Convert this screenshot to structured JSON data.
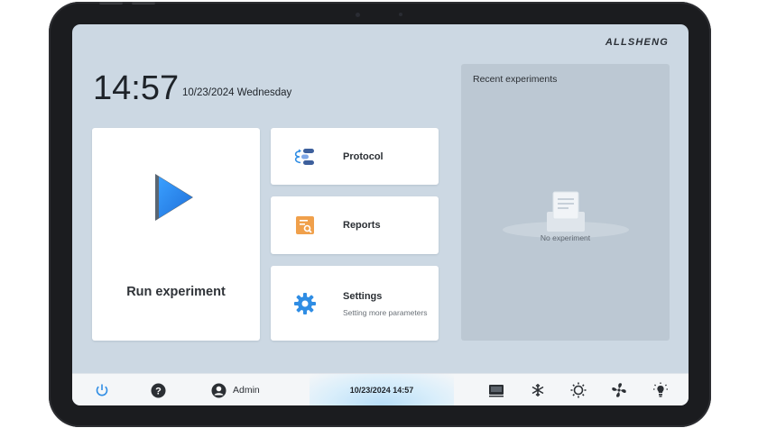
{
  "brand": "ALLSHENG",
  "clock": {
    "time": "14:57",
    "date": "10/23/2024 Wednesday"
  },
  "run": {
    "label": "Run experiment",
    "icon": "play-icon"
  },
  "menu": [
    {
      "title": "Protocol",
      "subtitle": "",
      "icon": "protocol-icon"
    },
    {
      "title": "Reports",
      "subtitle": "",
      "icon": "report-icon"
    },
    {
      "title": "Settings",
      "subtitle": "Setting more parameters",
      "icon": "gear-icon"
    }
  ],
  "recent": {
    "title": "Recent experiments",
    "empty_text": "No experiment"
  },
  "bottom_bar": {
    "user": "Admin",
    "datetime": "10/23/2024 14:57",
    "icons": [
      "power-icon",
      "help-icon",
      "user-icon",
      "screen-icon",
      "snowflake-icon",
      "brightness-icon",
      "fan-icon",
      "bulb-icon"
    ]
  },
  "colors": {
    "accent": "#2f8de4",
    "screen_bg": "#ccd8e3",
    "panel_bg": "#bcc8d3",
    "report_orange": "#f0a04b",
    "play_blue": "#2d8cf0"
  }
}
